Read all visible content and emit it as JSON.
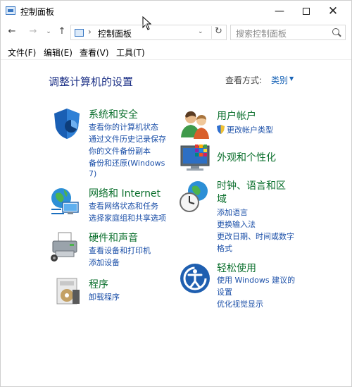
{
  "window": {
    "title": "控制面板",
    "controls": {
      "minimize": "—",
      "close": "✕"
    }
  },
  "address_bar": {
    "back": "←",
    "forward": "→",
    "recent": "⌄",
    "up": "↑",
    "separator": "›",
    "path": "控制面板",
    "dropdown": "⌄",
    "refresh": "↻"
  },
  "search": {
    "placeholder": "搜索控制面板"
  },
  "menu": [
    "文件(F)",
    "编辑(E)",
    "查看(V)",
    "工具(T)"
  ],
  "main": {
    "heading": "调整计算机的设置",
    "view_by_label": "查看方式:",
    "view_by_value": "类别",
    "view_by_arrow": "▼"
  },
  "categories": [
    {
      "title": "系统和安全",
      "icon": "shield-icon",
      "links": [
        "查看你的计算机状态",
        "通过文件历史记录保存",
        "你的文件备份副本",
        "备份和还原(Windows",
        "7)"
      ]
    },
    {
      "title": "网络和 Internet",
      "icon": "network-globe-icon",
      "links": [
        "查看网络状态和任务",
        "选择家庭组和共享选项"
      ]
    },
    {
      "title": "硬件和声音",
      "icon": "printer-icon",
      "links": [
        "查看设备和打印机",
        "添加设备"
      ]
    },
    {
      "title": "程序",
      "icon": "programs-icon",
      "links": [
        "卸载程序"
      ]
    },
    {
      "title": "用户帐户",
      "icon": "users-icon",
      "links": [
        "更改帐户类型"
      ]
    },
    {
      "title": "外观和个性化",
      "icon": "monitor-icon",
      "links": []
    },
    {
      "title_lines": [
        "时钟、语言和区",
        "域"
      ],
      "icon": "clock-globe-icon",
      "links": [
        "添加语言",
        "更换输入法",
        "更改日期、时间或数字",
        "格式"
      ]
    },
    {
      "title": "轻松使用",
      "icon": "ease-of-access-icon",
      "links": [
        "使用 Windows 建议的",
        "设置",
        "优化视觉显示"
      ]
    }
  ]
}
